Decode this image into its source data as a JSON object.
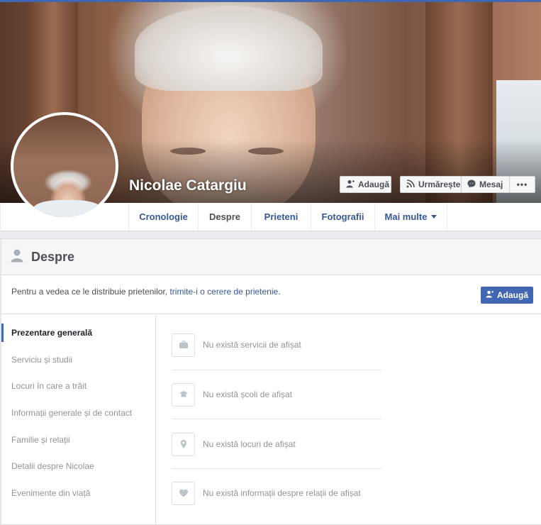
{
  "profile": {
    "name": "Nicolae Catargiu"
  },
  "cover_actions": {
    "add_friend": "Adaugă",
    "follow": "Urmărește",
    "message": "Mesaj",
    "more": "•••"
  },
  "tabs": [
    {
      "label": "Cronologie"
    },
    {
      "label": "Despre"
    },
    {
      "label": "Prieteni"
    },
    {
      "label": "Fotografii"
    },
    {
      "label": "Mai multe"
    }
  ],
  "about": {
    "title": "Despre",
    "notice_text": "Pentru a vedea ce le distribuie prietenilor, ",
    "notice_link": "trimite-i o cerere de prietenie",
    "notice_end": ".",
    "add_button": "Adaugă"
  },
  "nav": [
    {
      "label": "Prezentare generală",
      "active": true
    },
    {
      "label": "Serviciu și studii"
    },
    {
      "label": "Locuri în care a trăit"
    },
    {
      "label": "Informații generale și de contact"
    },
    {
      "label": "Familie și relații"
    },
    {
      "label": "Detalii despre Nicolae"
    },
    {
      "label": "Evenimente din viață"
    }
  ],
  "overview": [
    {
      "icon": "briefcase-icon",
      "text": "Nu există servicii de afișat"
    },
    {
      "icon": "graduation-cap-icon",
      "text": "Nu există școli de afișat"
    },
    {
      "icon": "location-pin-icon",
      "text": "Nu există locuri de afișat"
    },
    {
      "icon": "heart-icon",
      "text": "Nu există informații despre relații de afișat"
    }
  ],
  "colors": {
    "brand_blue": "#4267b2",
    "link_blue": "#365899",
    "muted_text": "#90949c"
  }
}
